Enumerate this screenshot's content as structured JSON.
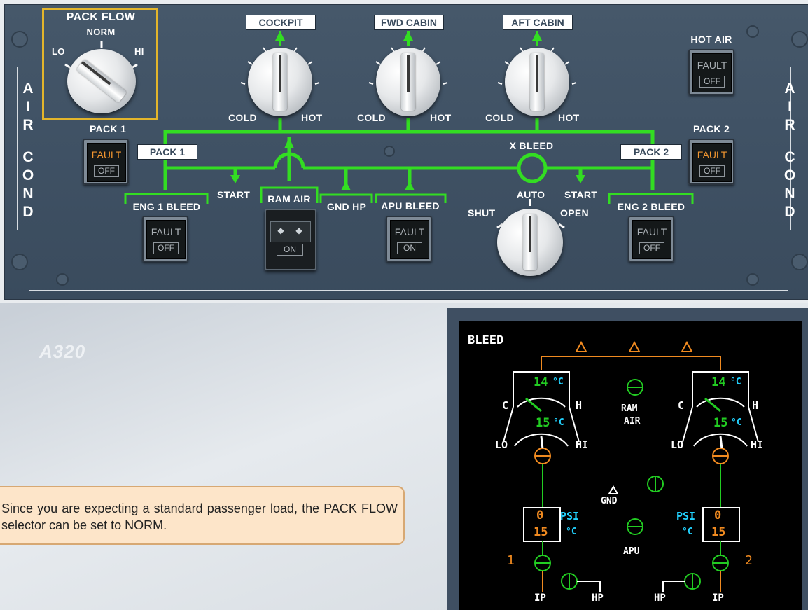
{
  "panel": {
    "pack_flow": {
      "title": "PACK FLOW",
      "norm": "NORM",
      "lo": "LO",
      "hi": "HI"
    },
    "temp_zones": [
      {
        "label": "COCKPIT",
        "cold": "COLD",
        "hot": "HOT"
      },
      {
        "label": "FWD CABIN",
        "cold": "COLD",
        "hot": "HOT"
      },
      {
        "label": "AFT CABIN",
        "cold": "COLD",
        "hot": "HOT"
      }
    ],
    "hot_air": {
      "label": "HOT AIR",
      "fault": "FAULT",
      "off": "OFF"
    },
    "side_label_left": {
      "line1": [
        "A",
        "I",
        "R"
      ],
      "line2": [
        "C",
        "O",
        "N",
        "D"
      ]
    },
    "side_label_right": {
      "line1": [
        "A",
        "I",
        "R"
      ],
      "line2": [
        "C",
        "O",
        "N",
        "D"
      ]
    },
    "pack1": {
      "label": "PACK 1",
      "box": "PACK 1",
      "fault": "FAULT",
      "off": "OFF"
    },
    "pack2": {
      "label": "PACK 2",
      "box": "PACK 2",
      "fault": "FAULT",
      "off": "OFF"
    },
    "x_bleed": {
      "label": "X BLEED",
      "auto": "AUTO",
      "shut": "SHUT",
      "open": "OPEN"
    },
    "start_left": "START",
    "start_right": "START",
    "eng1_bleed": {
      "label": "ENG 1 BLEED",
      "fault": "FAULT",
      "off": "OFF"
    },
    "ram_air": {
      "label": "RAM AIR",
      "on": "ON"
    },
    "gnd_hp": "GND HP",
    "apu_bleed": {
      "label": "APU BLEED",
      "fault": "FAULT",
      "on": "ON"
    },
    "eng2_bleed": {
      "label": "ENG 2 BLEED",
      "fault": "FAULT",
      "off": "OFF"
    }
  },
  "watermark": "A320",
  "bubble": {
    "text": "Since you are expecting a standard passenger load, the PACK FLOW selector can be set to NORM."
  },
  "ecam": {
    "title": "BLEED",
    "left": {
      "outlet_temp": "14",
      "outlet_unit": "°C",
      "c": "C",
      "h": "H",
      "inlet_temp": "15",
      "inlet_unit": "°C",
      "lo": "LO",
      "hi": "HI",
      "psi_val": "0",
      "temp_val": "15",
      "engine_num": "1",
      "ip": "IP",
      "hp": "HP"
    },
    "right": {
      "outlet_temp": "14",
      "outlet_unit": "°C",
      "c": "C",
      "h": "H",
      "inlet_temp": "15",
      "inlet_unit": "°C",
      "lo": "LO",
      "hi": "HI",
      "psi_val": "0",
      "temp_val": "15",
      "engine_num": "2",
      "ip": "IP",
      "hp": "HP"
    },
    "ram_air": [
      "RAM",
      "AIR"
    ],
    "gnd": "GND",
    "apu": "APU",
    "psi_label": "PSI",
    "temp_unit_label": "°C",
    "colors": {
      "green": "#22cc22",
      "amber": "#f08a20",
      "cyan": "#22d2ff",
      "white": "#ffffff"
    }
  }
}
